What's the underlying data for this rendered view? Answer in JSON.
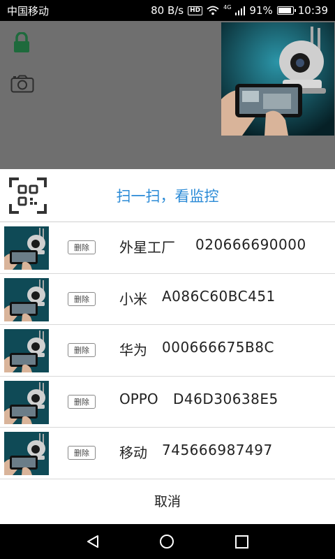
{
  "status_bar": {
    "carrier": "中国移动",
    "net_speed": "80 B/s",
    "hd": "HD",
    "network": "4G",
    "battery": "91%",
    "battery_level": 0.91,
    "time": "10:39"
  },
  "sheet": {
    "scan_label": "扫一扫，看监控",
    "cancel_label": "取消",
    "devices": [
      {
        "delete_label": "删除",
        "name": "外星工厂",
        "id": "020666690000"
      },
      {
        "delete_label": "删除",
        "name": "小米",
        "id": "A086C60BC451"
      },
      {
        "delete_label": "删除",
        "name": "华为",
        "id": "000666675B8C"
      },
      {
        "delete_label": "删除",
        "name": "OPPO",
        "id": "D46D30638E5"
      },
      {
        "delete_label": "删除",
        "name": "移动",
        "id": "745666987497"
      }
    ]
  },
  "colors": {
    "accent": "#2a8ad6",
    "lock_green": "#1e6a3c",
    "dim_overlay": "#6f6f6f"
  }
}
